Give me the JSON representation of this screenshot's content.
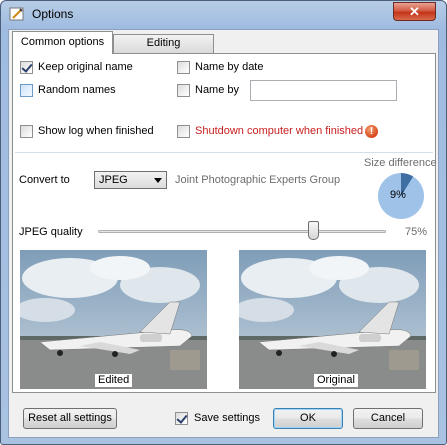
{
  "window": {
    "title": "Options",
    "close_glyph": "✕"
  },
  "tabs": [
    {
      "label": "Common options",
      "active": true
    },
    {
      "label": "Editing",
      "active": false
    }
  ],
  "options": {
    "keep_original_name": {
      "label": "Keep original name",
      "checked": true
    },
    "name_by_date": {
      "label": "Name by date",
      "checked": false
    },
    "random_names": {
      "label": "Random names",
      "checked": false
    },
    "name_by": {
      "label": "Name by",
      "checked": false,
      "value": ""
    },
    "show_log": {
      "label": "Show log when finished",
      "checked": false
    },
    "shutdown": {
      "label": "Shutdown computer when finished",
      "checked": false,
      "warning_glyph": "!"
    }
  },
  "convert": {
    "label": "Convert to",
    "selected": "JPEG",
    "description": "Joint Photographic Experts Group"
  },
  "size_difference": {
    "label": "Size difference",
    "value_text": "9%",
    "fraction": 0.09
  },
  "quality": {
    "label": "JPEG quality",
    "value_text": "75%",
    "value": 75
  },
  "previews": {
    "edited_caption": "Edited",
    "original_caption": "Original"
  },
  "footer": {
    "reset_label": "Reset all settings",
    "save_settings_label": "Save settings",
    "save_settings_checked": true,
    "ok_label": "OK",
    "cancel_label": "Cancel"
  },
  "colors": {
    "warning_text": "#c81e1e",
    "pie_fill": "#9ec2e8",
    "pie_slice": "#3f6ea3",
    "accent": "#3c7fb1"
  }
}
